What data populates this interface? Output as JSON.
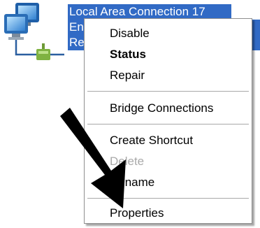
{
  "connection": {
    "name": "Local Area Connection 17",
    "line2": "Ena",
    "line3": "Re"
  },
  "menu": {
    "disable": "Disable",
    "status": "Status",
    "repair": "Repair",
    "bridge": "Bridge Connections",
    "create_shortcut": "Create Shortcut",
    "delete": "Delete",
    "rename": "Rename",
    "properties": "Properties"
  },
  "colors": {
    "selection": "#316ac5",
    "arrow": "#000000",
    "disabled_text": "#a9a9a9"
  },
  "icons": {
    "connection": "network-connection-icon",
    "pointer": "black-arrow"
  }
}
